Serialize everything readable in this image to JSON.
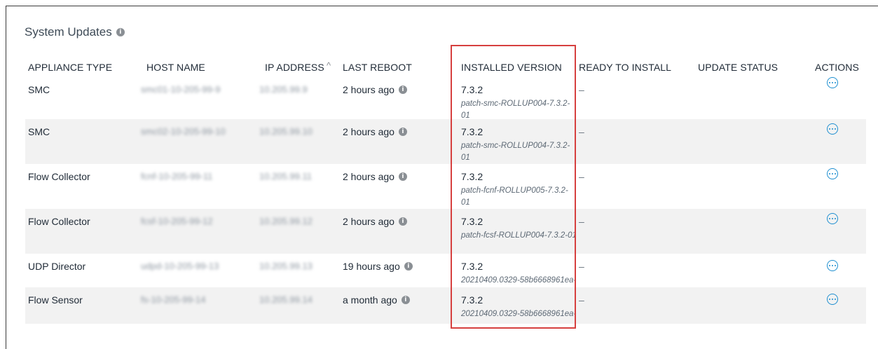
{
  "panel": {
    "title": "System Updates"
  },
  "columns": {
    "appliance_type": "APPLIANCE TYPE",
    "host_name": "HOST NAME",
    "ip_address": "IP ADDRESS",
    "sort_indicator": "^",
    "last_reboot": "LAST REBOOT",
    "installed_version": "INSTALLED VERSION",
    "ready_to_install": "READY TO INSTALL",
    "update_status": "UPDATE STATUS",
    "actions": "ACTIONS"
  },
  "rows": [
    {
      "appliance_type": "SMC",
      "host_name": "smc01-10-205-99-9",
      "ip_address": "10.205.99.9",
      "last_reboot": "2 hours ago",
      "version": "7.3.2",
      "patch": "patch-smc-ROLLUP004-7.3.2-01",
      "ready_to_install": "–",
      "update_status": ""
    },
    {
      "appliance_type": "SMC",
      "host_name": "smc02-10-205-99-10",
      "ip_address": "10.205.99.10",
      "last_reboot": "2 hours ago",
      "version": "7.3.2",
      "patch": "patch-smc-ROLLUP004-7.3.2-01",
      "ready_to_install": "–",
      "update_status": ""
    },
    {
      "appliance_type": "Flow Collector",
      "host_name": "fcnf-10-205-99-11",
      "ip_address": "10.205.99.11",
      "last_reboot": "2 hours ago",
      "version": "7.3.2",
      "patch": "patch-fcnf-ROLLUP005-7.3.2-01",
      "ready_to_install": "–",
      "update_status": ""
    },
    {
      "appliance_type": "Flow Collector",
      "host_name": "fcsf-10-205-99-12",
      "ip_address": "10.205.99.12",
      "last_reboot": "2 hours ago",
      "version": "7.3.2",
      "patch": "patch-fcsf-ROLLUP004-7.3.2-01",
      "ready_to_install": "–",
      "update_status": ""
    },
    {
      "appliance_type": "UDP Director",
      "host_name": "udpd-10-205-99-13",
      "ip_address": "10.205.99.13",
      "last_reboot": "19 hours ago",
      "version": "7.3.2",
      "patch": "20210409.0329-58b6668961ea-",
      "ready_to_install": "–",
      "update_status": ""
    },
    {
      "appliance_type": "Flow Sensor",
      "host_name": "fs-10-205-99-14",
      "ip_address": "10.205.99.14",
      "last_reboot": "a month ago",
      "version": "7.3.2",
      "patch": "20210409.0329-58b6668961ea-",
      "ready_to_install": "–",
      "update_status": ""
    }
  ],
  "icons": {
    "info": "info-icon",
    "actions": "ellipsis-circle-icon"
  },
  "colors": {
    "accent": "#1e8fd0",
    "highlight": "#d6403f",
    "row_alt": "#f2f2f2"
  }
}
